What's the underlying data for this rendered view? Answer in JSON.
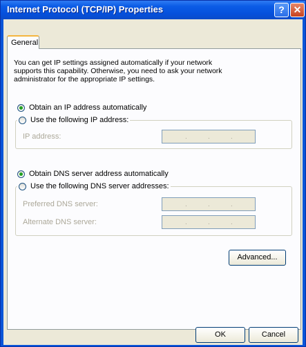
{
  "window": {
    "title": "Internet Protocol (TCP/IP) Properties",
    "help_glyph": "?",
    "close_glyph": "✕"
  },
  "tabs": [
    {
      "label": "General",
      "active": true
    }
  ],
  "intro_text": "You can get IP settings assigned automatically if your network\nsupports this capability. Otherwise, you need to ask your network\nadministrator for the appropriate IP settings.",
  "ip_section": {
    "auto_label": "Obtain an IP address automatically",
    "manual_label": "Use the following IP address:",
    "selected": "auto",
    "ip_address_label": "IP address:",
    "dots": "."
  },
  "dns_section": {
    "auto_label": "Obtain DNS server address automatically",
    "manual_label": "Use the following DNS server addresses:",
    "selected": "auto",
    "preferred_label": "Preferred DNS server:",
    "alternate_label": "Alternate DNS server:"
  },
  "buttons": {
    "advanced": "Advanced...",
    "ok": "OK",
    "cancel": "Cancel"
  },
  "colors": {
    "titlebar": "#0550dc",
    "face": "#ece9d8",
    "disabled_text": "#aca899",
    "radio_dot": "#21a121"
  }
}
